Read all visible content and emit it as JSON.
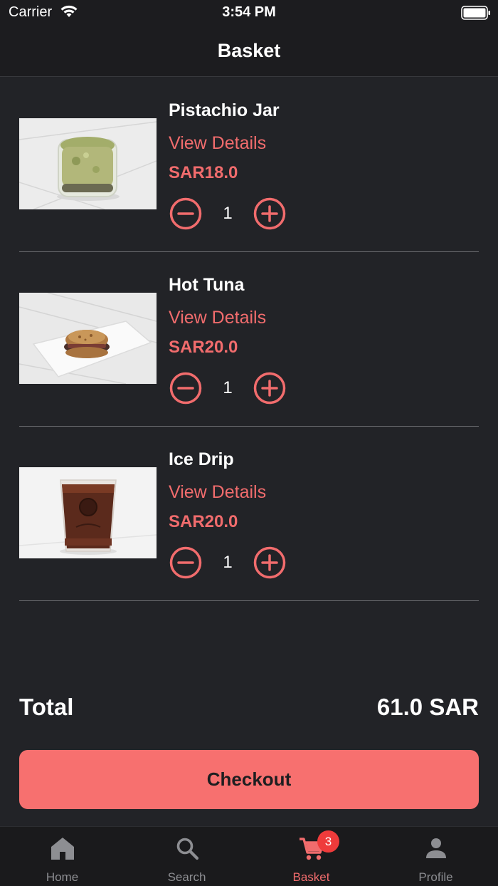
{
  "status_bar": {
    "carrier": "Carrier",
    "time": "3:54 PM"
  },
  "nav": {
    "title": "Basket"
  },
  "items": [
    {
      "name": "Pistachio Jar",
      "details_label": "View Details",
      "price": "SAR18.0",
      "quantity": "1",
      "image": "pistachio-jar-photo"
    },
    {
      "name": "Hot Tuna",
      "details_label": "View Details",
      "price": "SAR20.0",
      "quantity": "1",
      "image": "hot-tuna-sandwich-photo"
    },
    {
      "name": "Ice Drip",
      "details_label": "View Details",
      "price": "SAR20.0",
      "quantity": "1",
      "image": "ice-drip-coffee-photo"
    }
  ],
  "summary": {
    "total_label": "Total",
    "total_value": "61.0 SAR"
  },
  "checkout": {
    "label": "Checkout"
  },
  "tab_bar": {
    "tabs": [
      {
        "label": "Home",
        "icon": "home-icon",
        "active": false
      },
      {
        "label": "Search",
        "icon": "search-icon",
        "active": false
      },
      {
        "label": "Basket",
        "icon": "cart-icon",
        "active": true
      },
      {
        "label": "Profile",
        "icon": "profile-icon",
        "active": false
      }
    ],
    "basket_badge": "3"
  },
  "colors": {
    "accent": "#f16c6d",
    "button": "#f7706f",
    "background": "#222327",
    "badge": "#ef3b3b"
  }
}
